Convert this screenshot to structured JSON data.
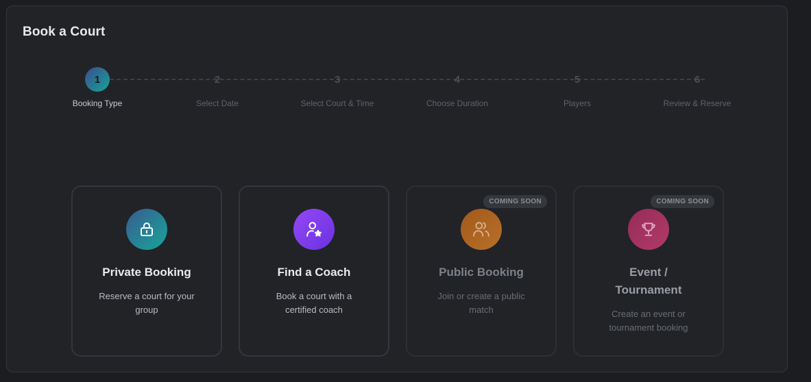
{
  "header": {
    "title": "Book a Court"
  },
  "steps": [
    {
      "number": "1",
      "label": "Booking Type"
    },
    {
      "number": "2",
      "label": "Select Date"
    },
    {
      "number": "3",
      "label": "Select Court & Time"
    },
    {
      "number": "4",
      "label": "Choose Duration"
    },
    {
      "number": "5",
      "label": "Players"
    },
    {
      "number": "6",
      "label": "Review & Reserve"
    }
  ],
  "active_step": 1,
  "cards": [
    {
      "icon": "lock-icon",
      "title": "Private Booking",
      "description": "Reserve a court for your group",
      "badge": "",
      "color": "#1aa39b"
    },
    {
      "icon": "coach-icon",
      "title": "Find a Coach",
      "description": "Book a court with a certified coach",
      "badge": "",
      "color": "#7b3ff0"
    },
    {
      "icon": "users-icon",
      "title": "Public Booking",
      "description": "Join or create a public match",
      "badge": "COMING SOON",
      "color": "#b0641f"
    },
    {
      "icon": "trophy-icon",
      "title": "Event / Tournament",
      "description": "Create an event or tournament booking",
      "badge": "COMING SOON",
      "color": "#a8325f"
    }
  ]
}
